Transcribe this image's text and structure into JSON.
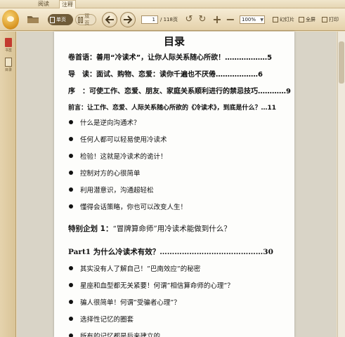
{
  "tabs": [
    {
      "label": "阅读",
      "active": false
    },
    {
      "label": "注释",
      "active": true
    }
  ],
  "toolbar": {
    "single_page_label": "单页",
    "double_page_label": "双页",
    "current_page": "1",
    "page_total": "/ 118页",
    "zoom": "100%",
    "slideshow_label": "幻灯片",
    "fullscreen_label": "全屏",
    "print_label": "打印"
  },
  "sidebar": {
    "bookmark_label": "书签",
    "toc_label": "目录"
  },
  "document": {
    "title": "目录",
    "toc_entries": [
      "卷首语：善用“冷读术”，让你人际关系随心所欲！………………5",
      "导　读：面试、购物、恋爱：读你千遍也不厌倦………………6",
      "序　：可使工作、恋爱、朋友、家庭关系顺利进行的禁忌技巧…………9",
      "前言：让工作、恋爱、人际关系随心所欲的《冷读术》，到底是什么？…11"
    ],
    "intro_bullets": [
      "什么是逆向沟通术？",
      "任何人都可以轻易使用冷读术",
      "检验！这就是冷读术的诡计！",
      "控制对方的心很简单",
      "利用潜意识，沟通超轻松",
      "懂得会话策略，你也可以改变人生！"
    ],
    "special_label": "特别企划 1：",
    "special_text": "“冒牌算命师”用冷读术能做到什么？",
    "part1_heading": "Part1 为什么冷读术有效？……………………………………30",
    "part1_bullets": [
      "其实没有人了解自己！”巴南效应”的秘密",
      "星座和血型都无关紧要！何谓”相信算命师的心理”？",
      "骗人很简单！何谓”受骗者心理”？",
      "选择性记忆的圈套",
      "所有的记忆都是后来建立的"
    ]
  },
  "colors": {
    "toolbar_bg": "#e9dcbf",
    "accent": "#6f5b38",
    "page_bg": "#fdfdfb"
  }
}
